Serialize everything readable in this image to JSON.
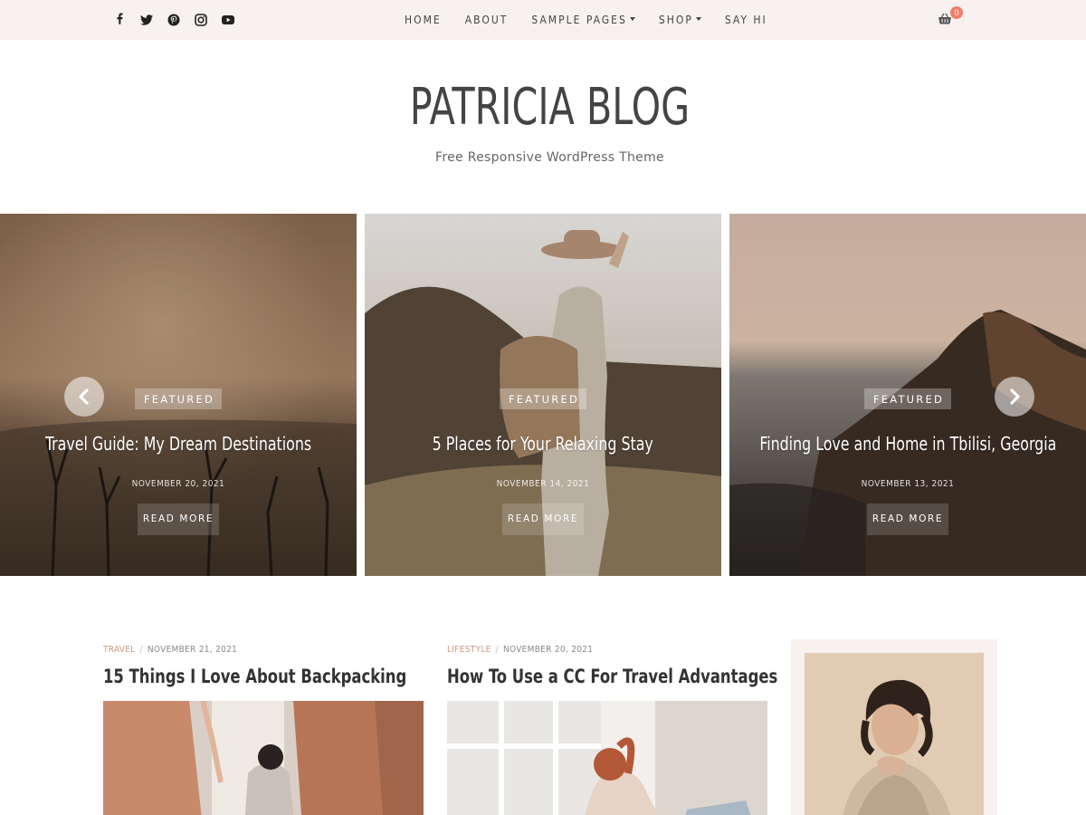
{
  "topbar": {
    "social_icons": [
      "facebook-icon",
      "twitter-icon",
      "pinterest-icon",
      "instagram-icon",
      "youtube-icon"
    ],
    "nav": [
      {
        "label": "HOME",
        "has_dropdown": false
      },
      {
        "label": "ABOUT",
        "has_dropdown": false
      },
      {
        "label": "SAMPLE PAGES",
        "has_dropdown": true
      },
      {
        "label": "SHOP",
        "has_dropdown": true
      },
      {
        "label": "SAY HI",
        "has_dropdown": false
      }
    ],
    "cart_count": "0",
    "colors": {
      "bar_bg": "#f7f2ef",
      "badge": "#ef7f6b"
    }
  },
  "branding": {
    "title": "PATRICIA BLOG",
    "tagline": "Free Responsive WordPress Theme"
  },
  "slider": {
    "slides": [
      {
        "badge": "FEATURED",
        "title": "Travel Guide: My Dream Destinations",
        "date": "NOVEMBER 20, 2021",
        "button": "READ MORE"
      },
      {
        "badge": "FEATURED",
        "title": "5 Places for Your Relaxing Stay",
        "date": "NOVEMBER 14, 2021",
        "button": "READ MORE"
      },
      {
        "badge": "FEATURED",
        "title": "Finding Love and Home in Tbilisi, Georgia",
        "date": "NOVEMBER 13, 2021",
        "button": "READ MORE"
      }
    ],
    "prev_icon": "chevron-left-icon",
    "next_icon": "chevron-right-icon"
  },
  "posts": [
    {
      "category": "TRAVEL",
      "date": "NOVEMBER 21, 2021",
      "title": "15 Things I Love About Backpacking"
    },
    {
      "category": "LIFESTYLE",
      "date": "NOVEMBER 20, 2021",
      "title": "How To Use a CC For Travel Advantages"
    }
  ],
  "accent_color": "#d0977e"
}
